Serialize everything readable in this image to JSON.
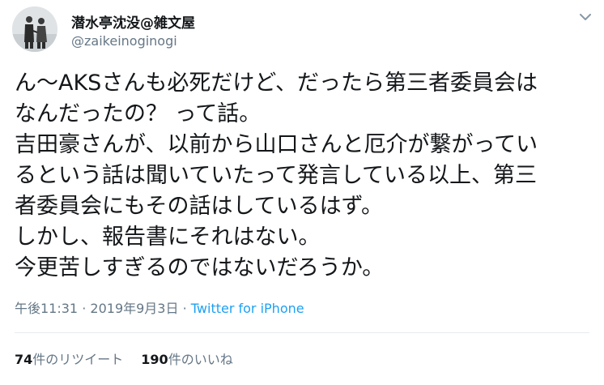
{
  "tweet": {
    "display_name": "潜水亭沈没@雑文屋",
    "handle": "@zaikeinoginogi",
    "icons": {
      "avatar": "profile-photo",
      "caret": "chevron-down-icon"
    },
    "text_lines": [
      "ん〜AKSさんも必死だけど、だったら第三者委員会は",
      "なんだったの？ って話。",
      "吉田豪さんが、以前から山口さんと厄介が繋がってい",
      "るという話は聞いていたって発言している以上、第三",
      "者委員会にもその話はしているはず。",
      "しかし、報告書にそれはない。",
      "今更苦しすぎるのではないだろうか。"
    ],
    "time": "午後11:31",
    "separator": "·",
    "date": "2019年9月3日",
    "source": "Twitter for iPhone",
    "retweets": {
      "count": "74",
      "label": "件のリツイート"
    },
    "likes": {
      "count": "190",
      "label": "件のいいね"
    },
    "colors": {
      "text": "#14171a",
      "secondary": "#657786",
      "link": "#1da1f2",
      "divider": "#e6ecf0"
    }
  }
}
